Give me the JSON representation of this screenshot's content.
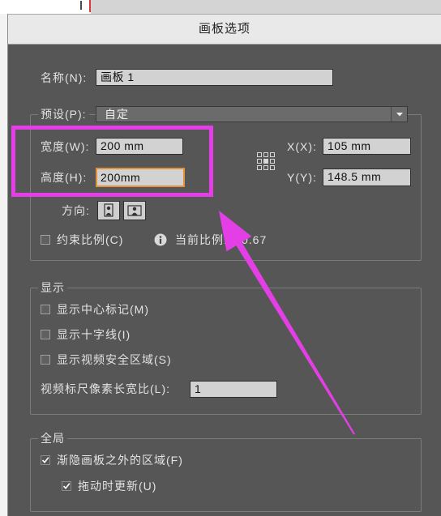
{
  "window": {
    "title": "画板选项"
  },
  "name_field": {
    "label": "名称(N):",
    "value": "画板 1"
  },
  "preset": {
    "label": "预设(P):",
    "value": "自定",
    "icon": "chevron-down-icon"
  },
  "size": {
    "width": {
      "label": "宽度(W):",
      "value": "200 mm"
    },
    "height": {
      "label": "高度(H):",
      "value": "200mm",
      "focused": true
    },
    "x": {
      "label": "X(X):",
      "value": "105 mm"
    },
    "y": {
      "label": "Y(Y):",
      "value": "148.5 mm"
    },
    "reference_point_icon": "reference-point-grid-icon"
  },
  "orientation": {
    "label": "方向:",
    "icons": [
      "portrait-orientation-icon",
      "landscape-orientation-icon"
    ]
  },
  "constrain": {
    "label": "约束比例(C)",
    "checked": false,
    "info_icon": "info-icon",
    "ratio_label": "当前比例:",
    "ratio_value": "0.67"
  },
  "display": {
    "group_label": "显示",
    "options": [
      {
        "label": "显示中心标记(M)",
        "checked": false
      },
      {
        "label": "显示十字线(I)",
        "checked": false
      },
      {
        "label": "显示视频安全区域(S)",
        "checked": false
      }
    ],
    "pixel_aspect_label": "视频标尺像素长宽比(L):",
    "pixel_aspect_value": "1"
  },
  "global": {
    "group_label": "全局",
    "fade_label": "渐隐画板之外的区域(F)",
    "fade_checked": true,
    "update_label": "拖动时更新(U)",
    "update_checked": true
  },
  "colors": {
    "annotation": "#e43fe6",
    "focus_ring": "#e3913a",
    "panel": "#565656"
  }
}
